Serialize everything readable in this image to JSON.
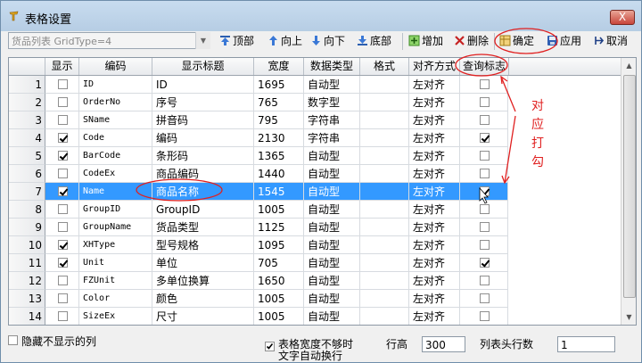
{
  "window": {
    "title": "表格设置",
    "close_label": "X"
  },
  "toolbar": {
    "gridtype": "货品列表 GridType=4",
    "buttons": {
      "top": "顶部",
      "up": "向上",
      "down": "向下",
      "bottom": "底部",
      "add": "增加",
      "delete": "删除",
      "confirm": "确定",
      "apply": "应用",
      "cancel": "取消"
    }
  },
  "grid": {
    "headers": [
      "显示",
      "编码",
      "显示标题",
      "宽度",
      "数据类型",
      "格式",
      "对齐方式",
      "查询标志"
    ],
    "rows": [
      {
        "n": "1",
        "show": false,
        "code": "ID",
        "title": "ID",
        "width": "1695",
        "type": "自动型",
        "format": "",
        "align": "左对齐",
        "query": false
      },
      {
        "n": "2",
        "show": false,
        "code": "OrderNo",
        "title": "序号",
        "width": "765",
        "type": "数字型",
        "format": "",
        "align": "左对齐",
        "query": false
      },
      {
        "n": "3",
        "show": false,
        "code": "SName",
        "title": "拼音码",
        "width": "795",
        "type": "字符串",
        "format": "",
        "align": "左对齐",
        "query": false
      },
      {
        "n": "4",
        "show": true,
        "code": "Code",
        "title": "编码",
        "width": "2130",
        "type": "字符串",
        "format": "",
        "align": "左对齐",
        "query": true
      },
      {
        "n": "5",
        "show": true,
        "code": "BarCode",
        "title": "条形码",
        "width": "1365",
        "type": "自动型",
        "format": "",
        "align": "左对齐",
        "query": false
      },
      {
        "n": "6",
        "show": false,
        "code": "CodeEx",
        "title": "商品编码",
        "width": "1440",
        "type": "自动型",
        "format": "",
        "align": "左对齐",
        "query": false
      },
      {
        "n": "7",
        "show": true,
        "code": "Name",
        "title": "商品名称",
        "width": "1545",
        "type": "自动型",
        "format": "",
        "align": "左对齐",
        "query": true,
        "selected": true
      },
      {
        "n": "8",
        "show": false,
        "code": "GroupID",
        "title": "GroupID",
        "width": "1005",
        "type": "自动型",
        "format": "",
        "align": "左对齐",
        "query": false
      },
      {
        "n": "9",
        "show": false,
        "code": "GroupName",
        "title": "货品类型",
        "width": "1125",
        "type": "自动型",
        "format": "",
        "align": "左对齐",
        "query": false
      },
      {
        "n": "10",
        "show": true,
        "code": "XHType",
        "title": "型号规格",
        "width": "1095",
        "type": "自动型",
        "format": "",
        "align": "左对齐",
        "query": false
      },
      {
        "n": "11",
        "show": true,
        "code": "Unit",
        "title": "单位",
        "width": "705",
        "type": "自动型",
        "format": "",
        "align": "左对齐",
        "query": true
      },
      {
        "n": "12",
        "show": false,
        "code": "FZUnit",
        "title": "多单位换算",
        "width": "1650",
        "type": "自动型",
        "format": "",
        "align": "左对齐",
        "query": false
      },
      {
        "n": "13",
        "show": false,
        "code": "Color",
        "title": "颜色",
        "width": "1005",
        "type": "自动型",
        "format": "",
        "align": "左对齐",
        "query": false
      },
      {
        "n": "14",
        "show": false,
        "code": "SizeEx",
        "title": "尺寸",
        "width": "1005",
        "type": "自动型",
        "format": "",
        "align": "左对齐",
        "query": false
      }
    ]
  },
  "annotation": {
    "text_chars": [
      "对",
      "应",
      "打",
      "勾"
    ],
    "color": "#e02020"
  },
  "footer": {
    "hide_label": "隐藏不显示的列",
    "hide_checked": false,
    "wrap_label_1": "表格宽度不够时",
    "wrap_label_2": "文字自动换行",
    "wrap_checked": true,
    "row_height_label": "行高",
    "row_height_value": "300",
    "header_rows_label": "列表头行数",
    "header_rows_value": "1"
  }
}
